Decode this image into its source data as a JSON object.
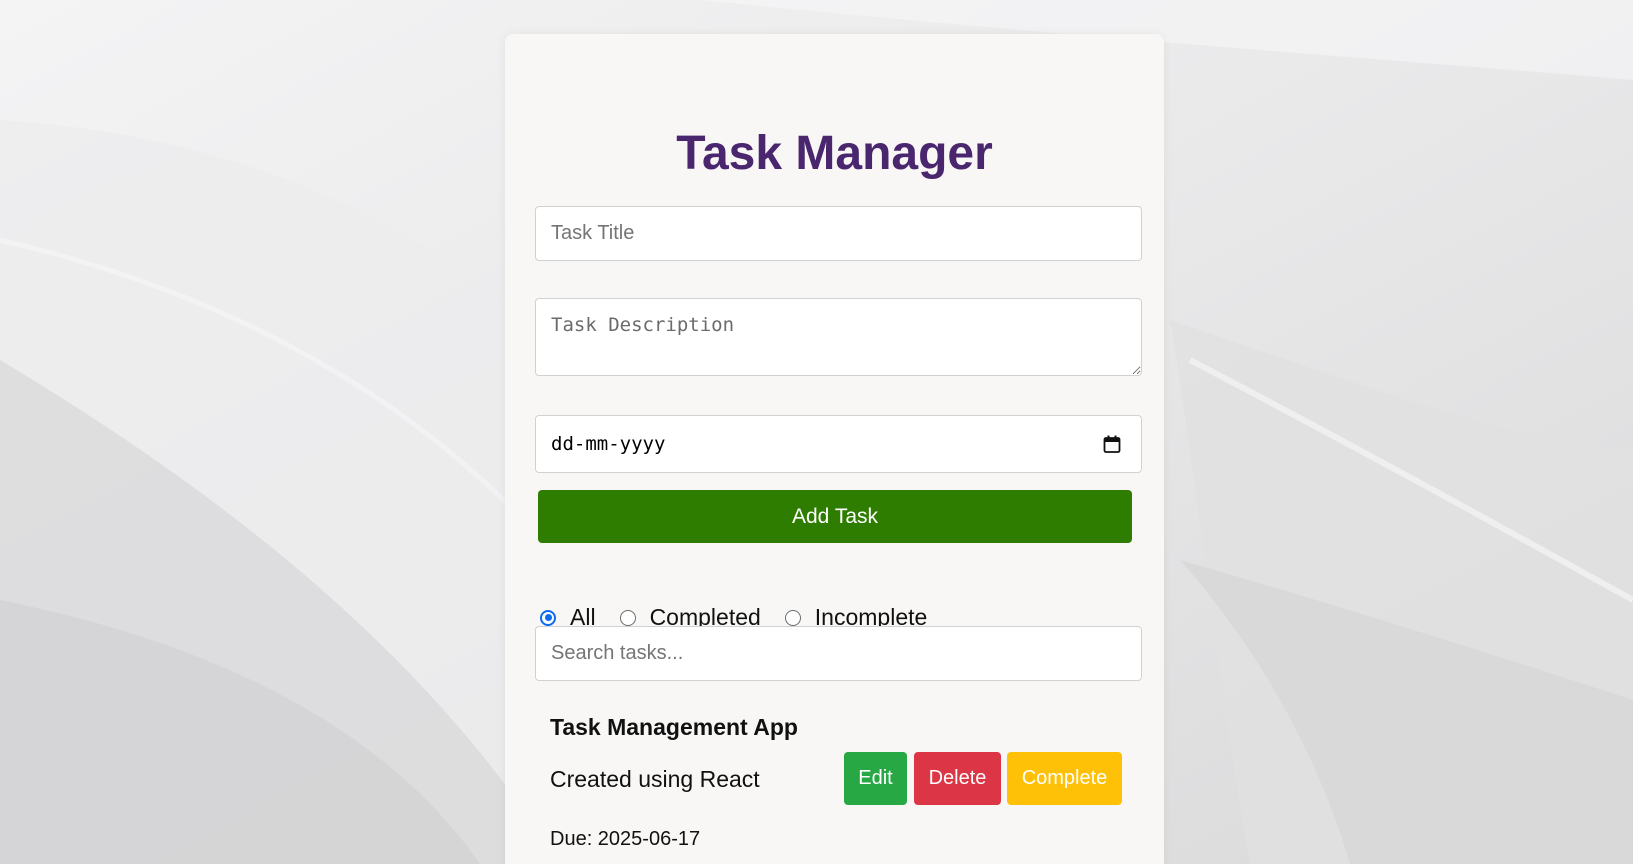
{
  "app": {
    "title": "Task Manager"
  },
  "form": {
    "title_placeholder": "Task Title",
    "description_placeholder": "Task Description",
    "date_placeholder": "dd-mm-yyyy",
    "add_button_label": "Add Task"
  },
  "filters": {
    "options": [
      {
        "label": "All",
        "checked": true
      },
      {
        "label": "Completed",
        "checked": false
      },
      {
        "label": "Incomplete",
        "checked": false
      }
    ]
  },
  "search": {
    "placeholder": "Search tasks..."
  },
  "tasks": [
    {
      "title": "Task Management App",
      "description": "Created using React",
      "due": "Due: 2025-06-17",
      "edit_label": "Edit",
      "delete_label": "Delete",
      "complete_label": "Complete"
    }
  ],
  "colors": {
    "title": "#4a266e",
    "add_button": "#2e7d00",
    "edit_button": "#28a745",
    "delete_button": "#dc3545",
    "complete_button": "#ffc107",
    "radio_accent": "#0b6cf0"
  },
  "icons": {
    "date": "calendar-icon"
  }
}
